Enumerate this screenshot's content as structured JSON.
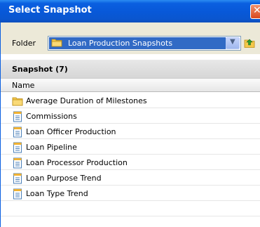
{
  "window": {
    "title": "Select Snapshot"
  },
  "folder": {
    "label": "Folder",
    "selected": "Loan Production Snapshots"
  },
  "section": {
    "title": "Snapshot (7)"
  },
  "list": {
    "column_header": "Name",
    "items": [
      {
        "label": "Average Duration of Milestones",
        "icon": "folder-icon"
      },
      {
        "label": "Commissions",
        "icon": "document-icon"
      },
      {
        "label": "Loan Officer Production",
        "icon": "document-icon"
      },
      {
        "label": "Loan Pipeline",
        "icon": "document-icon"
      },
      {
        "label": "Loan Processor Production",
        "icon": "document-icon"
      },
      {
        "label": "Loan Purpose Trend",
        "icon": "document-icon"
      },
      {
        "label": "Loan Type Trend",
        "icon": "document-icon"
      }
    ]
  },
  "colors": {
    "titlebar": "#0858d8",
    "selection": "#316ac5",
    "dialog_bg": "#ece9d8"
  }
}
